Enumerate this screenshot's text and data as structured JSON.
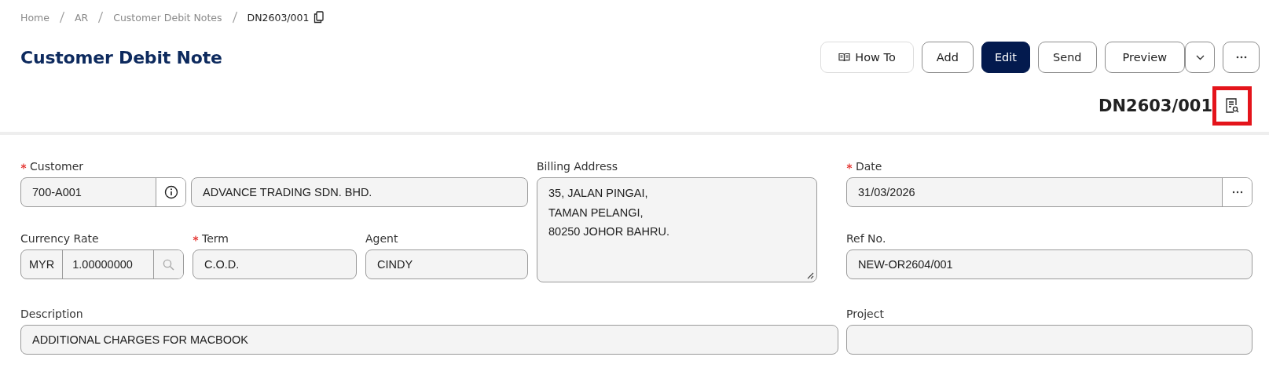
{
  "breadcrumb": [
    {
      "label": "Home",
      "current": false
    },
    {
      "label": "AR",
      "current": false
    },
    {
      "label": "Customer Debit Notes",
      "current": false
    },
    {
      "label": "DN2603/001",
      "current": true
    }
  ],
  "page_title": "Customer Debit Note",
  "toolbar": [
    {
      "kind": "help",
      "label": "How To"
    },
    {
      "kind": "outline",
      "label": "Add"
    },
    {
      "kind": "primary",
      "label": "Edit"
    },
    {
      "kind": "outline",
      "label": "Send"
    },
    {
      "kind": "split",
      "label": "Preview"
    },
    {
      "kind": "caret"
    },
    {
      "kind": "more"
    }
  ],
  "document": {
    "number": "DN2603/001",
    "preview_highlighted": true
  },
  "form": {
    "customer": {
      "label": "Customer",
      "required": true,
      "code": "700-A001",
      "name": "ADVANCE TRADING SDN. BHD."
    },
    "currency_rate": {
      "label": "Currency Rate",
      "required": false,
      "currency": "MYR",
      "rate": "1.00000000"
    },
    "term": {
      "label": "Term",
      "required": true,
      "value": "C.O.D."
    },
    "agent": {
      "label": "Agent",
      "required": false,
      "value": "CINDY"
    },
    "billing_address": {
      "label": "Billing Address",
      "required": false,
      "value": "35, JALAN PINGAI,\nTAMAN PELANGI,\n80250 JOHOR BAHRU."
    },
    "date": {
      "label": "Date",
      "required": true,
      "value": "31/03/2026"
    },
    "ref_no": {
      "label": "Ref No.",
      "required": false,
      "value": "NEW-OR2604/001"
    },
    "description": {
      "label": "Description",
      "required": false,
      "value": "ADDITIONAL CHARGES FOR MACBOOK"
    },
    "project": {
      "label": "Project",
      "required": false
    }
  }
}
